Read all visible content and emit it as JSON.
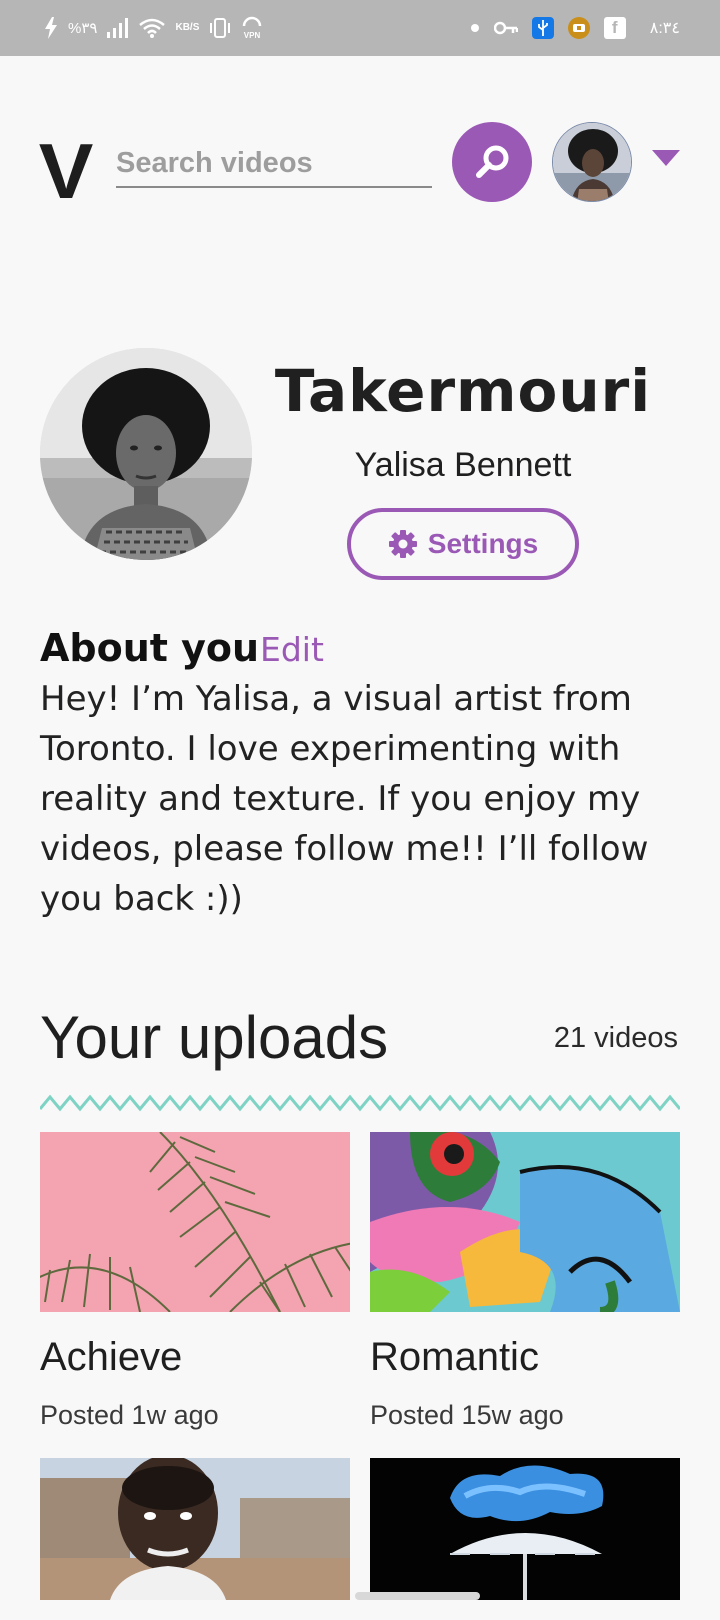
{
  "status_bar": {
    "battery_text": "%٣٩",
    "speed_unit": "KB/S",
    "vpn": "VPN",
    "time": "٨:٣٤",
    "facebook_glyph": "f"
  },
  "header": {
    "logo": "V",
    "search_placeholder": "Search videos",
    "search_icon": "search-icon",
    "accent": "#9b59b6"
  },
  "profile": {
    "username": "Takermouri",
    "full_name": "Yalisa Bennett",
    "settings_label": "Settings"
  },
  "about": {
    "heading": "About you",
    "edit_label": "Edit",
    "text": "Hey! I’m Yalisa, a visual artist from Toronto. I love experimenting with reality and texture. If you enjoy my videos, please follow me!! I’ll follow you back :))"
  },
  "uploads": {
    "title": "Your uploads",
    "count": "21 videos",
    "divider_color": "#7ed3c4",
    "videos": [
      {
        "title": "Achieve",
        "posted": "Posted 1w ago"
      },
      {
        "title": "Romantic",
        "posted": "Posted 15w ago"
      },
      {
        "title": "",
        "posted": ""
      },
      {
        "title": "",
        "posted": ""
      }
    ]
  }
}
